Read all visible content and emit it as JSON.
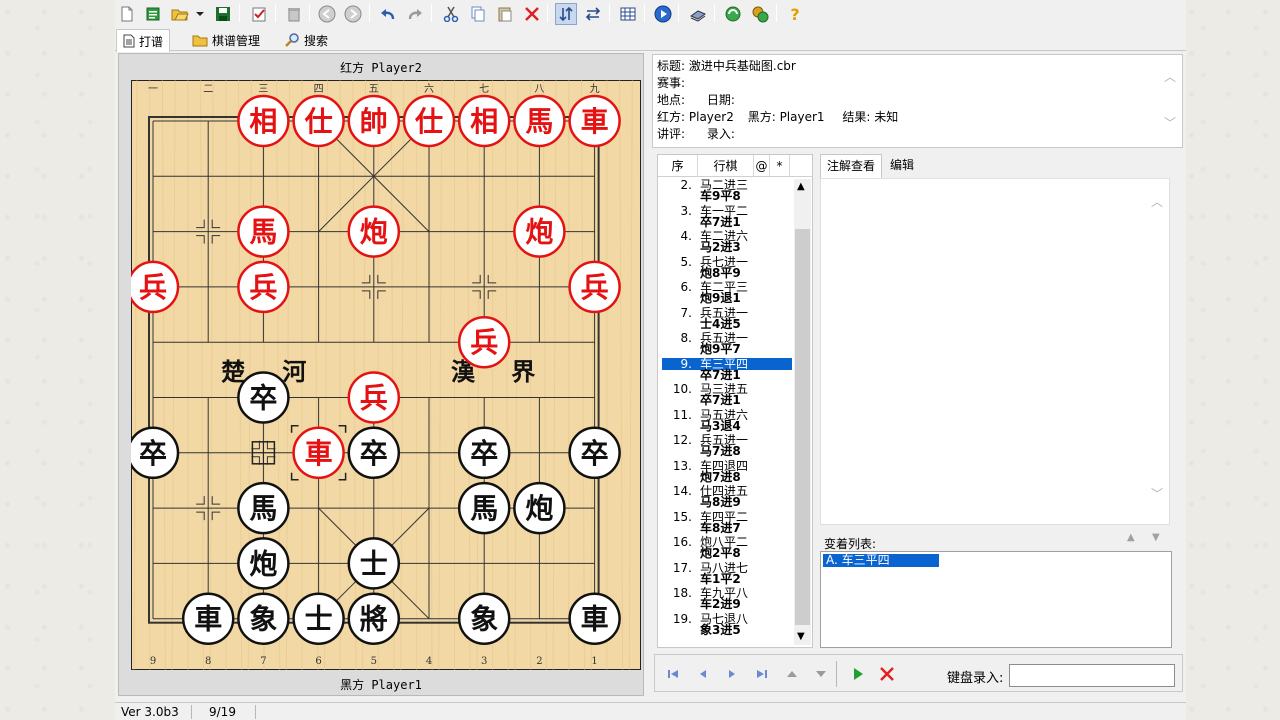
{
  "toolbar": {
    "icons": [
      "new-file-icon",
      "open-icon",
      "folder-open-icon",
      "dropdown-arrow-icon",
      "save-icon",
      "check-edit-icon",
      "delete-icon",
      "back-circle-icon",
      "forward-circle-icon",
      "undo-icon",
      "redo-icon",
      "cut-icon",
      "copy-icon",
      "paste-icon",
      "close-x-icon",
      "flip-vertical-icon",
      "swap-horizontal-icon",
      "board-view-icon",
      "play-circle-icon",
      "books-icon",
      "refresh-green-icon",
      "engine-icon",
      "help-icon"
    ]
  },
  "tabs": [
    {
      "label": "打谱",
      "icon": "document-icon",
      "selected": true
    },
    {
      "label": "棋谱管理",
      "icon": "folder-icon",
      "selected": false
    },
    {
      "label": "搜索",
      "icon": "magnifier-icon",
      "selected": false
    }
  ],
  "board": {
    "red_label": "红方 Player2",
    "black_label": "黑方 Player1",
    "top_numbers": [
      "一",
      "二",
      "三",
      "四",
      "五",
      "六",
      "七",
      "八",
      "九"
    ],
    "bottom_numbers": [
      "9",
      "8",
      "7",
      "6",
      "5",
      "4",
      "3",
      "2",
      "1"
    ],
    "river_left": [
      "楚",
      "河"
    ],
    "river_right": [
      "漢",
      "界"
    ],
    "colors": {
      "wood": "#f2d8a4",
      "red": "#e41212",
      "black": "#111111",
      "border": "#222222"
    },
    "pieces": [
      {
        "text": "相",
        "side": "red",
        "file": 2,
        "rank": 0
      },
      {
        "text": "仕",
        "side": "red",
        "file": 3,
        "rank": 0
      },
      {
        "text": "帥",
        "side": "red",
        "file": 4,
        "rank": 0
      },
      {
        "text": "仕",
        "side": "red",
        "file": 5,
        "rank": 0
      },
      {
        "text": "相",
        "side": "red",
        "file": 6,
        "rank": 0
      },
      {
        "text": "馬",
        "side": "red",
        "file": 7,
        "rank": 0
      },
      {
        "text": "車",
        "side": "red",
        "file": 8,
        "rank": 0
      },
      {
        "text": "馬",
        "side": "red",
        "file": 2,
        "rank": 2
      },
      {
        "text": "炮",
        "side": "red",
        "file": 4,
        "rank": 2
      },
      {
        "text": "炮",
        "side": "red",
        "file": 7,
        "rank": 2
      },
      {
        "text": "兵",
        "side": "red",
        "file": 0,
        "rank": 3
      },
      {
        "text": "兵",
        "side": "red",
        "file": 2,
        "rank": 3
      },
      {
        "text": "兵",
        "side": "red",
        "file": 8,
        "rank": 3
      },
      {
        "text": "兵",
        "side": "red",
        "file": 6,
        "rank": 4
      },
      {
        "text": "兵",
        "side": "red",
        "file": 4,
        "rank": 5
      },
      {
        "text": "車",
        "side": "red",
        "file": 3,
        "rank": 6
      },
      {
        "text": "卒",
        "side": "black",
        "file": 2,
        "rank": 5
      },
      {
        "text": "卒",
        "side": "black",
        "file": 0,
        "rank": 6
      },
      {
        "text": "卒",
        "side": "black",
        "file": 4,
        "rank": 6
      },
      {
        "text": "卒",
        "side": "black",
        "file": 6,
        "rank": 6
      },
      {
        "text": "卒",
        "side": "black",
        "file": 8,
        "rank": 6
      },
      {
        "text": "馬",
        "side": "black",
        "file": 2,
        "rank": 7
      },
      {
        "text": "馬",
        "side": "black",
        "file": 6,
        "rank": 7
      },
      {
        "text": "炮",
        "side": "black",
        "file": 7,
        "rank": 7
      },
      {
        "text": "炮",
        "side": "black",
        "file": 2,
        "rank": 8
      },
      {
        "text": "士",
        "side": "black",
        "file": 4,
        "rank": 8
      },
      {
        "text": "車",
        "side": "black",
        "file": 1,
        "rank": 9
      },
      {
        "text": "象",
        "side": "black",
        "file": 2,
        "rank": 9
      },
      {
        "text": "士",
        "side": "black",
        "file": 3,
        "rank": 9
      },
      {
        "text": "將",
        "side": "black",
        "file": 4,
        "rank": 9
      },
      {
        "text": "象",
        "side": "black",
        "file": 6,
        "rank": 9
      },
      {
        "text": "車",
        "side": "black",
        "file": 8,
        "rank": 9
      }
    ],
    "last_move_from": {
      "file": 2,
      "rank": 6
    },
    "selected_piece": {
      "file": 3,
      "rank": 6
    }
  },
  "info": {
    "title_label": "标题:",
    "title_value": "激进中兵基础图.cbr",
    "event_label": "赛事:",
    "place_label": "地点:",
    "date_label": "日期:",
    "red_label": "红方:",
    "red_value": "Player2",
    "black_label": "黑方:",
    "black_value": "Player1",
    "result_label": "结果:",
    "result_value": "未知",
    "comment_label": "讲评:",
    "entry_label": "录入:"
  },
  "moves": {
    "headers": [
      "序",
      "行棋",
      "@",
      "*"
    ],
    "rows": [
      {
        "num": "2.",
        "red": "马二进三",
        "black": "车9平8"
      },
      {
        "num": "3.",
        "red": "车一平二",
        "black": "卒7进1"
      },
      {
        "num": "4.",
        "red": "车二进六",
        "black": "马2进3"
      },
      {
        "num": "5.",
        "red": "兵七进一",
        "black": "炮8平9"
      },
      {
        "num": "6.",
        "red": "车二平三",
        "black": "炮9退1"
      },
      {
        "num": "7.",
        "red": "兵五进一",
        "black": "士4进5"
      },
      {
        "num": "8.",
        "red": "兵五进一",
        "black": "炮9平7"
      },
      {
        "num": "9.",
        "red": "车三平四",
        "black": "卒7进1",
        "selected": true
      },
      {
        "num": "10.",
        "red": "马三进五",
        "black": "卒7进1"
      },
      {
        "num": "11.",
        "red": "马五进六",
        "black": "马3退4"
      },
      {
        "num": "12.",
        "red": "兵五进一",
        "black": "马7进8"
      },
      {
        "num": "13.",
        "red": "车四退四",
        "black": "炮7进8"
      },
      {
        "num": "14.",
        "red": "仕四进五",
        "black": "马8进9"
      },
      {
        "num": "15.",
        "red": "车四平二",
        "black": "车8进7"
      },
      {
        "num": "16.",
        "red": "炮八平二",
        "black": "炮2平8"
      },
      {
        "num": "17.",
        "red": "马八进七",
        "black": "车1平2"
      },
      {
        "num": "18.",
        "red": "车九平八",
        "black": "车2进9"
      },
      {
        "num": "19.",
        "red": "马七退八",
        "black": "象3进5"
      }
    ]
  },
  "annotation": {
    "tab_view": "注解查看",
    "tab_edit": "编辑",
    "variations_label": "变着列表:",
    "variation_item": "A. 车三平四"
  },
  "nav": {
    "keyboard_label": "键盘录入:",
    "keyboard_value": ""
  },
  "status": {
    "version": "Ver 3.0b3",
    "position": "9/19"
  }
}
